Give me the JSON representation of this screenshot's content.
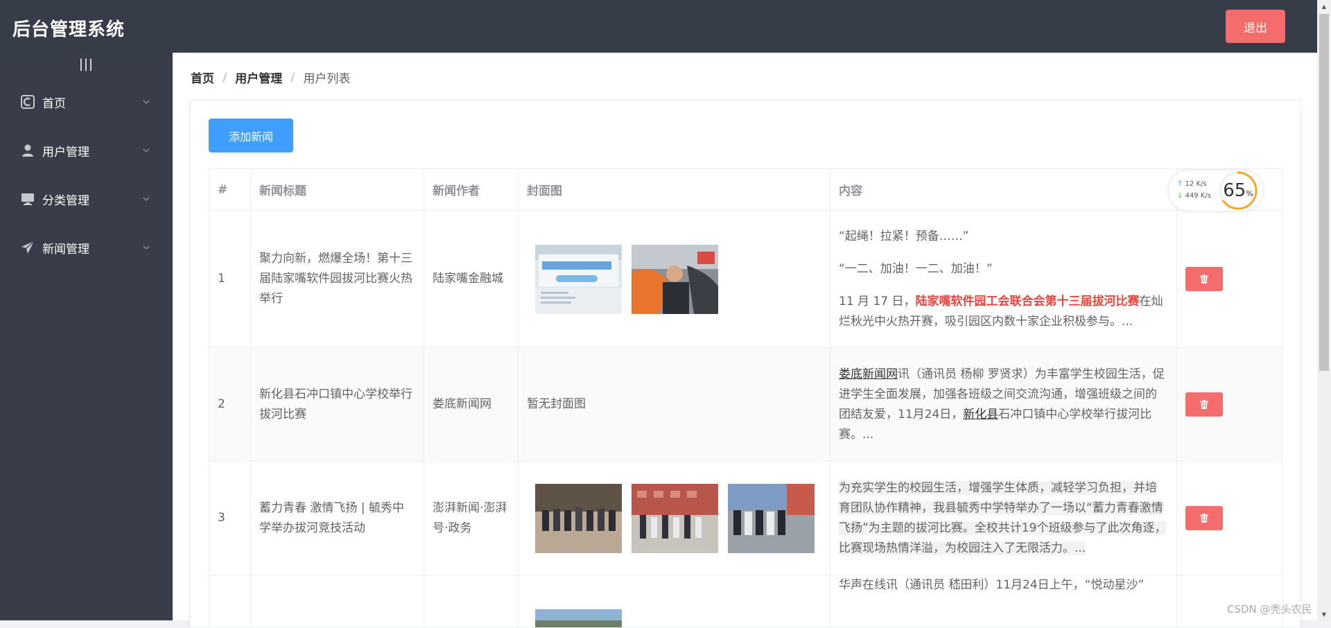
{
  "header": {
    "title": "后台管理系统",
    "logout_label": "退出"
  },
  "sidebar": {
    "toggle_label": "|||",
    "items": [
      {
        "label": "首页",
        "icon": "home-icon"
      },
      {
        "label": "用户管理",
        "icon": "user-icon"
      },
      {
        "label": "分类管理",
        "icon": "monitor-icon"
      },
      {
        "label": "新闻管理",
        "icon": "send-icon"
      }
    ]
  },
  "breadcrumb": {
    "items": [
      "首页",
      "用户管理",
      "用户列表"
    ],
    "separator": "/"
  },
  "toolbar": {
    "add_label": "添加新闻"
  },
  "table": {
    "columns": [
      "#",
      "新闻标题",
      "新闻作者",
      "封面图",
      "内容",
      ""
    ],
    "rows": [
      {
        "index": "1",
        "title": "聚力向新，燃爆全场！第十三届陆家嘴软件园拔河比赛火热举行",
        "author": "陆家嘴金融城",
        "content": {
          "p1": "“起绳！拉紧！预备……”",
          "p2": "“一二、加油！一二、加油！”",
          "p3_pre": "11 月 17 日，",
          "p3_hl": "陆家嘴软件园工会联合会第十三届拔河比赛",
          "p3_post": "在灿烂秋光中火热开赛，吸引园区内数十家企业积极参与。..."
        }
      },
      {
        "index": "2",
        "title": "新化县石冲口镇中心学校举行拔河比赛",
        "author": "娄底新闻网",
        "cover_empty": "暂无封面图",
        "content": {
          "link1": "娄底新闻网",
          "mid": "讯（通讯员 杨柳 罗贤求）为丰富学生校园生活，促进学生全面发展，加强各班级之间交流沟通，增强班级之间的团结友爱，11月24日，",
          "link2": "新化县",
          "end": "石冲口镇中心学校举行拔河比赛。..."
        }
      },
      {
        "index": "3",
        "title": "蓄力青春 激情飞扬 | 毓秀中学举办拔河竞技活动",
        "author": "澎湃新闻·澎湃号·政务",
        "content": {
          "text": "为充实学生的校园生活，增强学生体质，减轻学习负担，并培育团队协作精神，我县毓秀中学特举办了一场以“蓄力青春激情飞扬”为主题的拔河比赛。全校共计19个班级参与了此次角逐，比赛现场热情洋溢，为校园注入了无限活力。..."
        }
      },
      {
        "index": "",
        "title": "",
        "author": "",
        "content": {
          "text": "华声在线讯（通讯员 嵇田利）11月24日上午，“悦动星沙”"
        }
      }
    ]
  },
  "speed_widget": {
    "up": "12 K/s",
    "down": "449 K/s",
    "percent": "65",
    "percent_unit": "%",
    "percent_value": 65
  },
  "watermark": "CSDN @秃头农民",
  "colors": {
    "header_bg": "#373d48",
    "sidebar_bg": "#383d49",
    "primary": "#409eff",
    "danger": "#f56c6c",
    "highlight": "#e8453c"
  }
}
